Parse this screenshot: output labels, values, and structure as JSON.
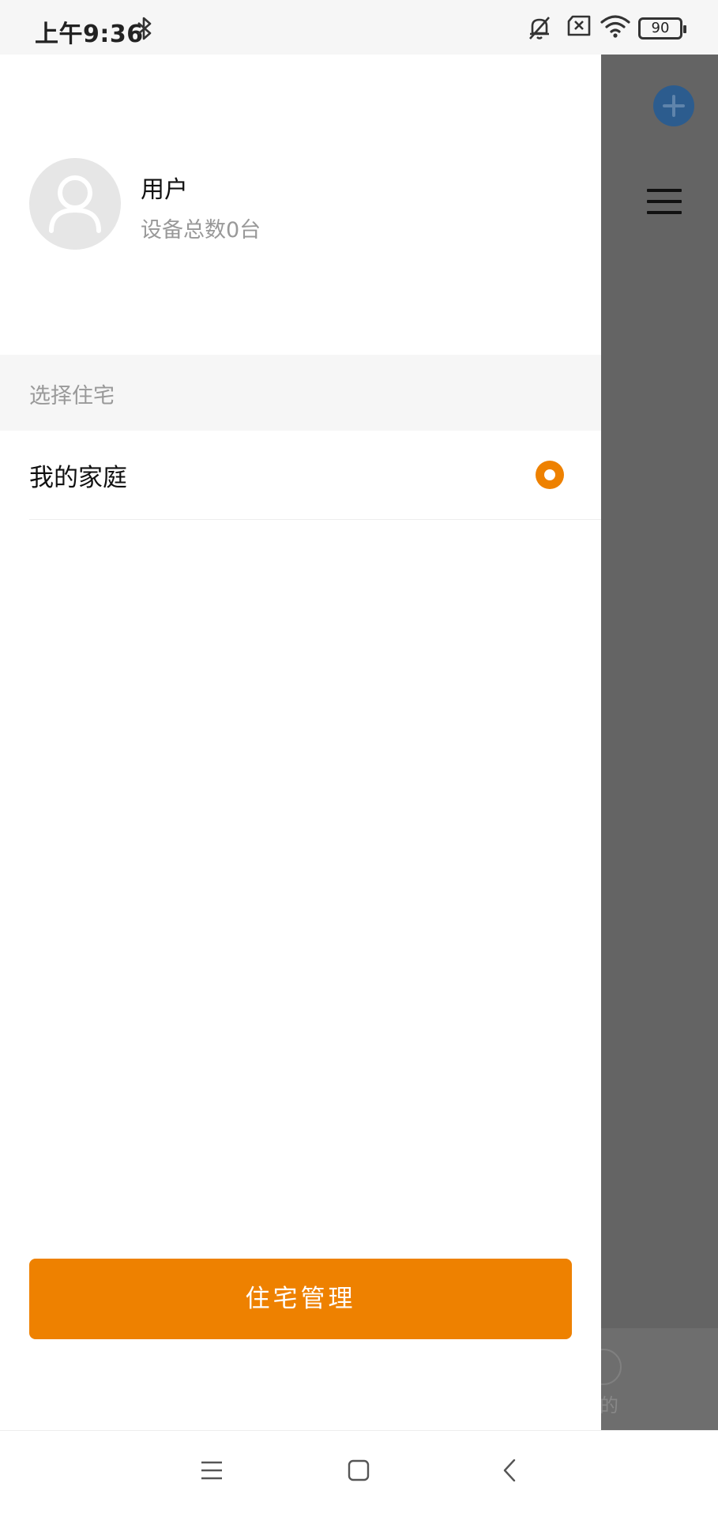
{
  "status_bar": {
    "time": "上午9:36",
    "battery_level": "90",
    "icons": [
      "bluetooth-icon",
      "mute-icon",
      "sim-off-icon",
      "wifi-icon",
      "battery-icon"
    ]
  },
  "drawer": {
    "user": {
      "name": "用户",
      "device_count": "设备总数0台"
    },
    "section_title": "选择住宅",
    "homes": [
      {
        "label": "我的家庭",
        "selected": true
      }
    ],
    "manage_button_label": "住宅管理"
  },
  "background_screen": {
    "tab_label_partial": "的"
  },
  "nav_bar": {
    "icons": [
      "menu-icon",
      "home-icon",
      "back-icon"
    ]
  },
  "colors": {
    "accent": "#ee8100",
    "overlay": "#646464",
    "status_bg": "#f6f6f6"
  }
}
